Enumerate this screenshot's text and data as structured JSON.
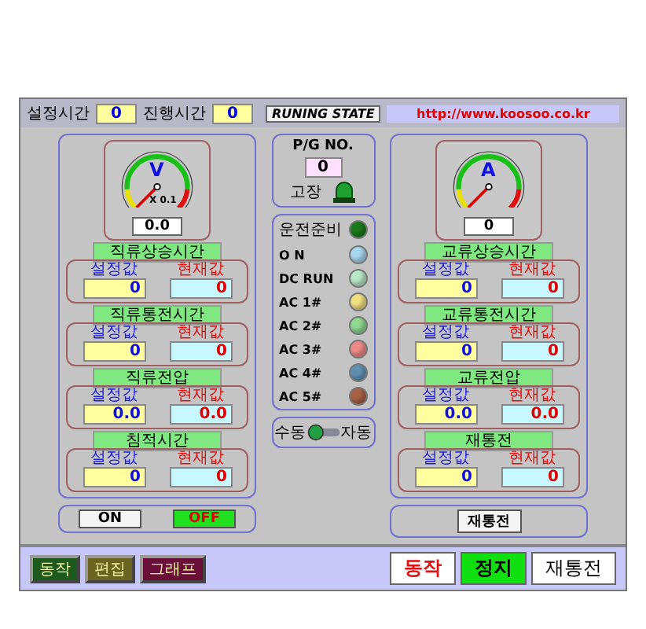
{
  "header": {
    "set_time_label": "설정시간",
    "set_time": "0",
    "elapsed_label": "진행시간",
    "elapsed": "0",
    "state": "RUNING STATE",
    "url": "http://www.koosoo.co.kr"
  },
  "dc_panel": {
    "gauge": {
      "unit": "V",
      "scale": "X 0.1",
      "reading": "0.0"
    },
    "params": [
      {
        "title": "직류상승시간",
        "set_label": "설정값",
        "set_value": "0",
        "cur_label": "현재값",
        "cur_value": "0"
      },
      {
        "title": "직류통전시간",
        "set_label": "설정값",
        "set_value": "0",
        "cur_label": "현재값",
        "cur_value": "0"
      },
      {
        "title": "직류전압",
        "set_label": "설정값",
        "set_value": "0.0",
        "cur_label": "현재값",
        "cur_value": "0.0"
      },
      {
        "title": "침적시간",
        "set_label": "설정값",
        "set_value": "0",
        "cur_label": "현재값",
        "cur_value": "0"
      }
    ],
    "buttons": [
      {
        "label": "ON",
        "on": false
      },
      {
        "label": "OFF",
        "on": true
      }
    ]
  },
  "status": {
    "pg_label": "P/G NO.",
    "pg_value": "0",
    "fault_label": "고장",
    "ready_label": "운전준비",
    "ready_on": true,
    "lamps": [
      {
        "label": "O N",
        "color": "#a8d8f0"
      },
      {
        "label": "DC RUN",
        "color": "#b8e8c8"
      },
      {
        "label": "AC 1#",
        "color": "#f0e080"
      },
      {
        "label": "AC 2#",
        "color": "#90d890"
      },
      {
        "label": "AC 3#",
        "color": "#f08888"
      },
      {
        "label": "AC 4#",
        "color": "#6090b0"
      },
      {
        "label": "AC 5#",
        "color": "#a86048"
      }
    ],
    "switch": {
      "left_label": "수동",
      "right_label": "자동",
      "auto": false
    }
  },
  "ac_panel": {
    "gauge": {
      "unit": "A",
      "reading": "0"
    },
    "params": [
      {
        "title": "교류상승시간",
        "set_label": "설정값",
        "set_value": "0",
        "cur_label": "현재값",
        "cur_value": "0"
      },
      {
        "title": "교류통전시간",
        "set_label": "설정값",
        "set_value": "0",
        "cur_label": "현재값",
        "cur_value": "0"
      },
      {
        "title": "교류전압",
        "set_label": "설정값",
        "set_value": "0.0",
        "cur_label": "현재값",
        "cur_value": "0.0"
      },
      {
        "title": "재통전",
        "set_label": "설정값",
        "set_value": "0",
        "cur_label": "현재값",
        "cur_value": "0"
      }
    ],
    "buttons": [
      {
        "label": "재통전",
        "on": false
      }
    ]
  },
  "footer": {
    "tabs": [
      {
        "label": "동작",
        "color": "#1e5a1e"
      },
      {
        "label": "편집",
        "color": "#6a6420"
      },
      {
        "label": "그래프",
        "color": "#6a1038"
      }
    ],
    "actions": [
      {
        "label": "동작",
        "kind": "start"
      },
      {
        "label": "정지",
        "kind": "stop"
      },
      {
        "label": "재통전",
        "kind": "retry"
      }
    ]
  }
}
